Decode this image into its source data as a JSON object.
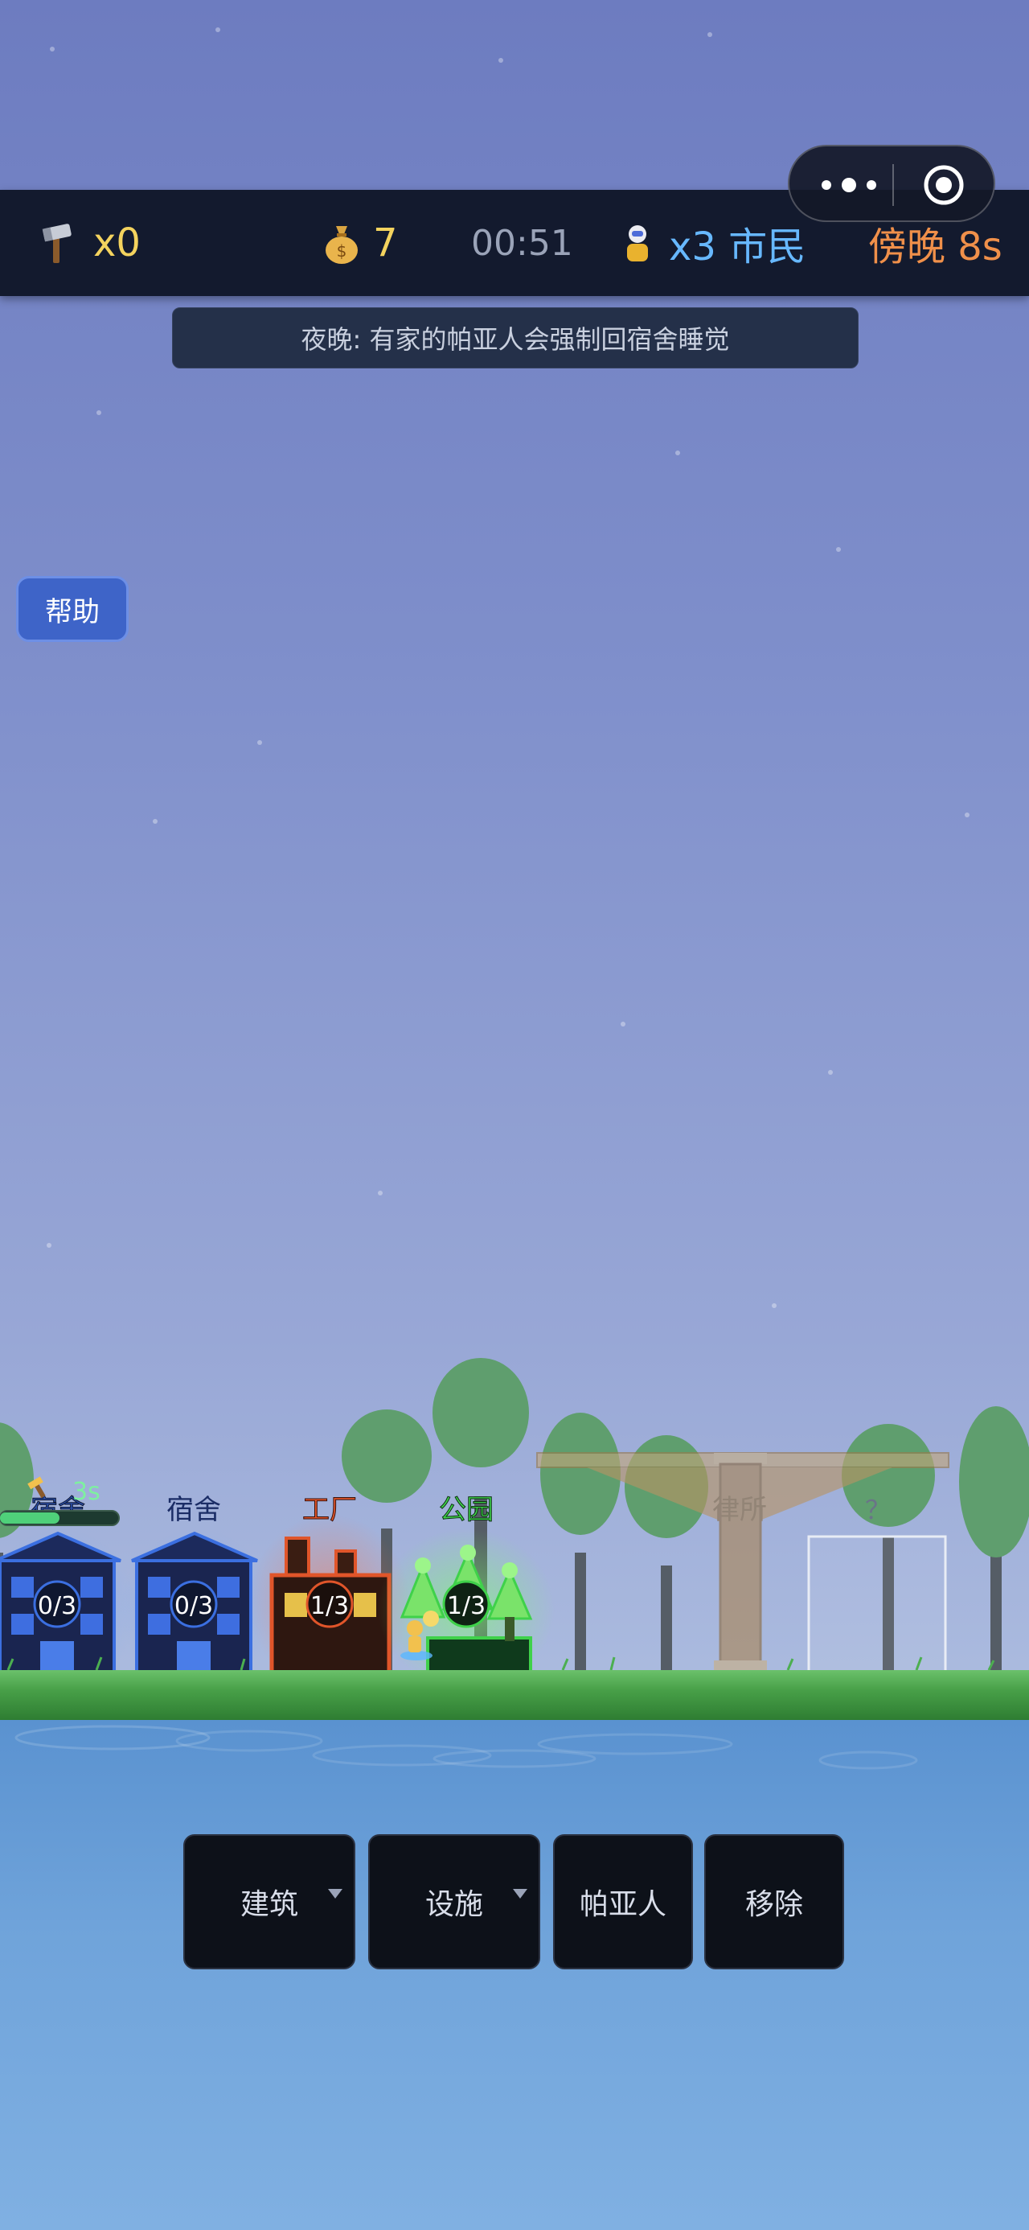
{
  "topbar": {
    "hammer_icon": "hammer-icon",
    "hammer_count": "x0",
    "money_icon": "money-bag-icon",
    "money_count": "7",
    "timer": "00:51",
    "citizen_icon": "citizen-icon",
    "citizen_text": "x3 市民",
    "phase": "傍晚 8s"
  },
  "notice": "夜晚: 有家的帕亚人会强制回宿舍睡觉",
  "help_label": "帮助",
  "buildings": [
    {
      "name": "宿舍",
      "occupancy": "0/3",
      "color": "#3b6fe0",
      "timer": "3s",
      "progress": 0.5
    },
    {
      "name": "宿舍",
      "occupancy": "0/3",
      "color": "#3b6fe0"
    },
    {
      "name": "工厂",
      "occupancy": "1/3",
      "color": "#e0552a"
    },
    {
      "name": "公园",
      "occupancy": "1/3",
      "color": "#3fd14a"
    },
    {
      "name": "律所",
      "color": "#b08b55"
    },
    {
      "name": "？"
    }
  ],
  "bottom_buttons": {
    "build": "建筑",
    "facility": "设施",
    "paya": "帕亚人",
    "remove": "移除"
  },
  "colors": {
    "topbar_bg": "#131a2e",
    "accent_gold": "#f4d35e",
    "accent_blue": "#67b8ff",
    "accent_orange": "#f0904a"
  }
}
